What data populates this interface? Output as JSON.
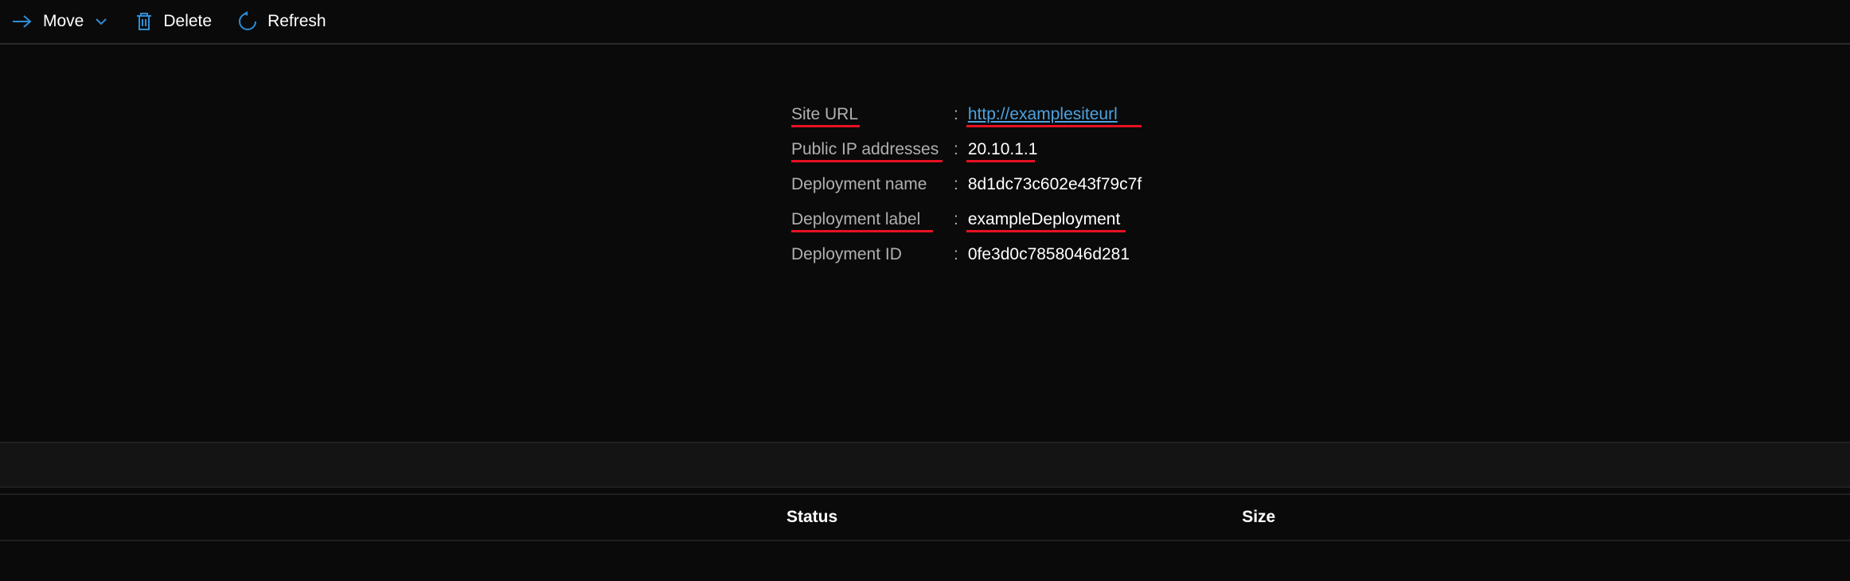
{
  "toolbar": {
    "move_label": "Move",
    "delete_label": "Delete",
    "refresh_label": "Refresh"
  },
  "details": {
    "site_url": {
      "label": "Site URL",
      "value": "http://examplesiteurl",
      "underlined": true,
      "is_link": true,
      "underline_label_width": 86,
      "underline_value_width": 220
    },
    "public_ip": {
      "label": "Public IP addresses",
      "value": "20.10.1.1",
      "underlined": true,
      "is_link": false,
      "underline_label_width": 190,
      "underline_value_width": 86
    },
    "deployment_name": {
      "label": "Deployment name",
      "value": "8d1dc73c602e43f79c7f",
      "underlined": false,
      "is_link": false
    },
    "deployment_label": {
      "label": "Deployment label",
      "value": "exampleDeployment",
      "underlined": true,
      "is_link": false,
      "underline_label_width": 178,
      "underline_value_width": 200
    },
    "deployment_id": {
      "label": "Deployment ID",
      "value": "0fe3d0c7858046d281",
      "underlined": false,
      "is_link": false
    }
  },
  "table": {
    "columns": {
      "status": "Status",
      "size": "Size"
    }
  }
}
